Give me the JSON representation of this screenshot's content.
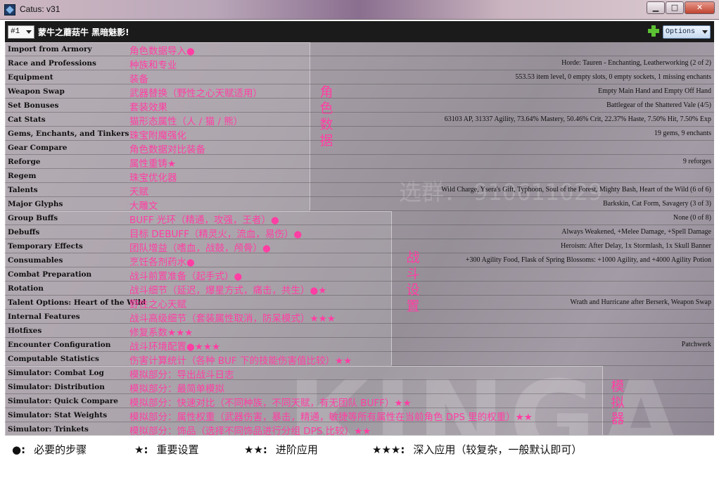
{
  "window": {
    "title": "Catus: v31",
    "minimize": "▁",
    "maximize": "□",
    "close": "✕"
  },
  "toolbar": {
    "selector": "#1",
    "character": "蒙牛之蘑菇牛 黑暗魅影!",
    "add_icon": "plus-icon",
    "options_label": "Options"
  },
  "rows": [
    {
      "label": "Import from Armory",
      "anno": "角色数据导入●",
      "value": ""
    },
    {
      "label": "Race and Professions",
      "anno": "种族和专业",
      "value": "Horde: Tauren - Enchanting, Leatherworking (2 of 2)"
    },
    {
      "label": "Equipment",
      "anno": "装备",
      "value": "553.53 item level, 0 empty slots, 0 empty sockets, 1 missing enchants"
    },
    {
      "label": "Weapon Swap",
      "anno": "武器替换（野性之心天赋适用）",
      "value": "Empty Main Hand and Empty Off Hand"
    },
    {
      "label": "Set Bonuses",
      "anno": "套装效果",
      "value": "Battlegear of the Shattered Vale (4/5)"
    },
    {
      "label": "Cat Stats",
      "anno": "猫形态属性（人 / 猫 / 熊）",
      "value": "63103 AP, 31337 Agility, 73.64% Mastery, 50.46% Crit, 22.37% Haste, 7.50% Hit, 7.50% Exp"
    },
    {
      "label": "Gems, Enchants, and Tinkers",
      "anno": "珠宝附魔强化",
      "value": "19 gems, 9 enchants"
    },
    {
      "label": "Gear Compare",
      "anno": "角色数据对比装备",
      "value": ""
    },
    {
      "label": "Reforge",
      "anno": "属性重铸★",
      "value": "9 reforges"
    },
    {
      "label": "Regem",
      "anno": "珠宝优化器",
      "value": ""
    },
    {
      "label": "Talents",
      "anno": "天赋",
      "value": "Wild Charge, Ysera's Gift, Typhoon, Soul of the Forest, Mighty Bash, Heart of the Wild (6 of 6)"
    },
    {
      "label": "Major Glyphs",
      "anno": "大雕文",
      "value": "Barkskin, Cat Form, Savagery (3 of 3)"
    },
    {
      "label": "Group Buffs",
      "anno": "BUFF 光环（精通，攻强，王者）●",
      "value": "None (0 of 8)"
    },
    {
      "label": "Debuffs",
      "anno": "目标 DEBUFF（精灵火，流血，易伤）●",
      "value": "Always Weakened, +Melee Damage, +Spell Damage"
    },
    {
      "label": "Temporary Effects",
      "anno": "团队增益（嗜血，战鼓，颅骨）●",
      "value": "Heroism: After Delay, 1x Stormlash, 1x Skull Banner"
    },
    {
      "label": "Consumables",
      "anno": "烹饪各剂药水●",
      "value": "+300 Agility Food, Flask of Spring Blossoms: +1000 Agility, and +4000 Agility Potion"
    },
    {
      "label": "Combat Preparation",
      "anno": "战斗前置准备（起手式）●",
      "value": ""
    },
    {
      "label": "Rotation",
      "anno": "战斗细节（延迟，爆星方式，痛击，共生）●★",
      "value": ""
    },
    {
      "label": "Talent Options: Heart of the Wild",
      "anno": "野性之心天赋",
      "value": "Wrath and Hurricane after Berserk, Weapon Swap"
    },
    {
      "label": "Internal Features",
      "anno": "战斗高级细节（套装属性取消，防呆模式）★★★",
      "value": ""
    },
    {
      "label": "Hotfixes",
      "anno": "修复系数★★★",
      "value": ""
    },
    {
      "label": "Encounter Configuration",
      "anno": "战斗环境配置●★★★",
      "value": "Patchwerk"
    },
    {
      "label": "Computable Statistics",
      "anno": "伤害计算统计（各种 BUF 下的技能伤害值比较）★★",
      "value": ""
    },
    {
      "label": "Simulator: Combat Log",
      "anno": "模拟部分：导出战斗日志",
      "value": ""
    },
    {
      "label": "Simulator: Distribution",
      "anno": "模拟部分：最简单模拟",
      "value": ""
    },
    {
      "label": "Simulator: Quick Compare",
      "anno": "模拟部分：快速对比（不同种族，不同天赋，有无团队 BUFF）★★",
      "value": ""
    },
    {
      "label": "Simulator: Stat Weights",
      "anno": "模拟部分：属性权重（武器伤害，暴击，精通，敏捷等所有属性在当前角色 DPS 里的权重）★★",
      "value": ""
    },
    {
      "label": "Simulator: Trinkets",
      "anno": "模拟部分：饰品（选择不同饰品进行分组 DPS 比较）★★",
      "value": ""
    }
  ],
  "vertical_annotations": {
    "role": "角色数据",
    "battle": "战斗设置",
    "sim": "模拟器"
  },
  "watermark": "KINGA",
  "faint_text": "选群： 910611029",
  "legend": [
    {
      "symbol": "●:",
      "text": "必要的步骤"
    },
    {
      "symbol": "★:",
      "text": "重要设置"
    },
    {
      "symbol": "★★:",
      "text": "进阶应用"
    },
    {
      "symbol": "★★★:",
      "text": "深入应用（较复杂，一般默认即可）"
    }
  ],
  "colors": {
    "annotation": "#ff3ea3",
    "toolbar": "#1b1b1b",
    "add_icon": "#5cc233"
  }
}
